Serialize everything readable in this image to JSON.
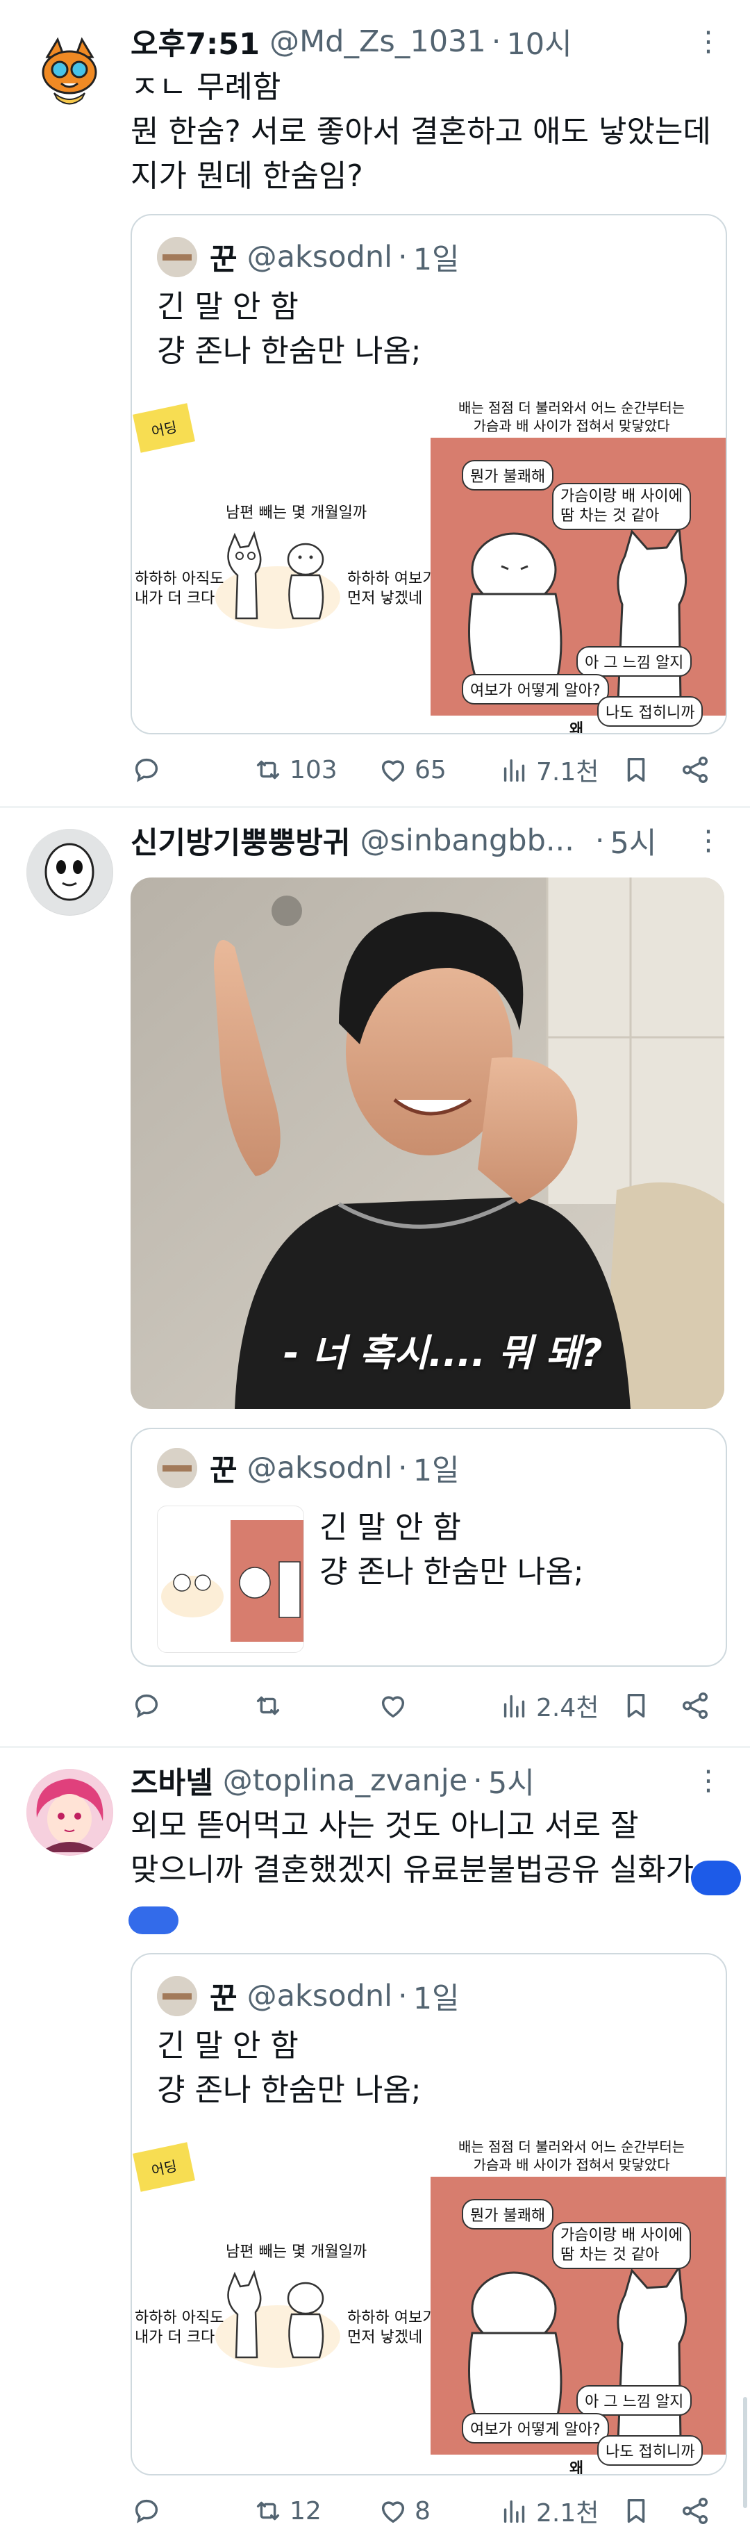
{
  "tweets": [
    {
      "name": "오후7:51",
      "handle": "@Md_Zs_1031",
      "time": "10시",
      "text_lines": [
        "ㅈㄴ 무례함",
        "뭔 한숨? 서로 좋아서 결혼하고 애도 낳았는데",
        "지가 뭔데 한숨임?"
      ],
      "quote": {
        "name": "꾼",
        "handle": "@aksodnl",
        "time": "1일",
        "lines": [
          "긴 말 안 함",
          "걍 존나 한숨만 나옴;"
        ],
        "sticker": "어딩",
        "left_title": "남편 빼는 몇 개월일까",
        "left_a": [
          "하하하 아직도",
          "내가 더 크다"
        ],
        "left_b": [
          "하하하 여보가",
          "먼저 낳겠네"
        ],
        "right_header": [
          "배는 점점 더 불러와서 어느 순간부터는",
          "가슴과 배 사이가 접혀서 맞닿았다"
        ],
        "bubbles": [
          "뭔가 불쾌해",
          "가슴이랑 배 사이에",
          "땀 차는 것 같아",
          "아 그 느낌 알지",
          "여보가 어떻게 알아?",
          "나도 접히니까"
        ],
        "bottom": "왜"
      },
      "actions": {
        "reply": "",
        "retweet": "103",
        "like": "65",
        "views": "7.1천"
      }
    },
    {
      "name": "신기방기뿡뿡방귀",
      "handle": "@sinbangbb...",
      "time": "5시",
      "photo_caption": "- 너 혹시.... 뭐 돼?",
      "quote": {
        "name": "꾼",
        "handle": "@aksodnl",
        "time": "1일",
        "lines": [
          "긴 말 안 함",
          "걍 존나 한숨만 나옴;"
        ]
      },
      "actions": {
        "reply": "",
        "retweet": "",
        "like": "",
        "views": "2.4천"
      }
    },
    {
      "name": "즈바넬",
      "handle": "@toplina_zvanje",
      "time": "5시",
      "text_lines": [
        "외모 뜯어먹고 사는 것도 아니고 서로 잘",
        "맞으니까 결혼했겠지 유료분불법공유 실화가"
      ],
      "quote": {
        "name": "꾼",
        "handle": "@aksodnl",
        "time": "1일",
        "lines": [
          "긴 말 안 함",
          "걍 존나 한숨만 나옴;"
        ]
      },
      "actions": {
        "reply": "",
        "retweet": "12",
        "like": "8",
        "views": "2.1천"
      }
    }
  ],
  "colors": {
    "text": "#0f1419",
    "muted": "#536471",
    "border": "#cfd9de",
    "panel": "#d77d6e",
    "redact": "#1d5be8"
  },
  "icons": [
    "more-icon",
    "reply-icon",
    "retweet-icon",
    "like-icon",
    "views-icon",
    "bookmark-icon",
    "share-icon"
  ]
}
